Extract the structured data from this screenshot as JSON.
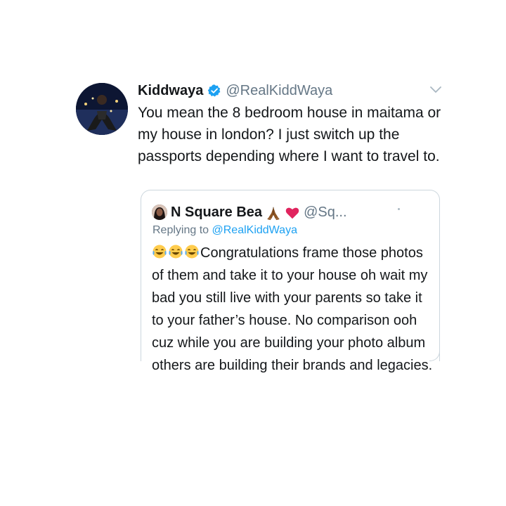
{
  "tweet": {
    "display_name": "Kiddwaya",
    "handle": "@RealKiddWaya",
    "text": "You mean the 8 bedroom house in maitama or my house in london? I just switch up the passports depending where I want to travel to.",
    "verified": true,
    "colors": {
      "verified": "#1da1f2",
      "handle": "#657786"
    }
  },
  "quoted_tweet": {
    "display_name": "N Square Bea",
    "name_emojis": [
      "folded-hands-icon",
      "red-heart-icon"
    ],
    "handle": "@Sq...",
    "replying_prefix": "Replying to ",
    "replying_to": "@RealKiddWaya",
    "leading_emojis": [
      "tears-of-joy-icon",
      "tears-of-joy-icon",
      "tears-of-joy-icon"
    ],
    "text": "Congratulations frame those photos  of them and take it to your house oh wait my bad you still live with your parents so take it to your father’s house. No comparison ooh cuz while you are building your photo album others are building their brands and legacies."
  }
}
